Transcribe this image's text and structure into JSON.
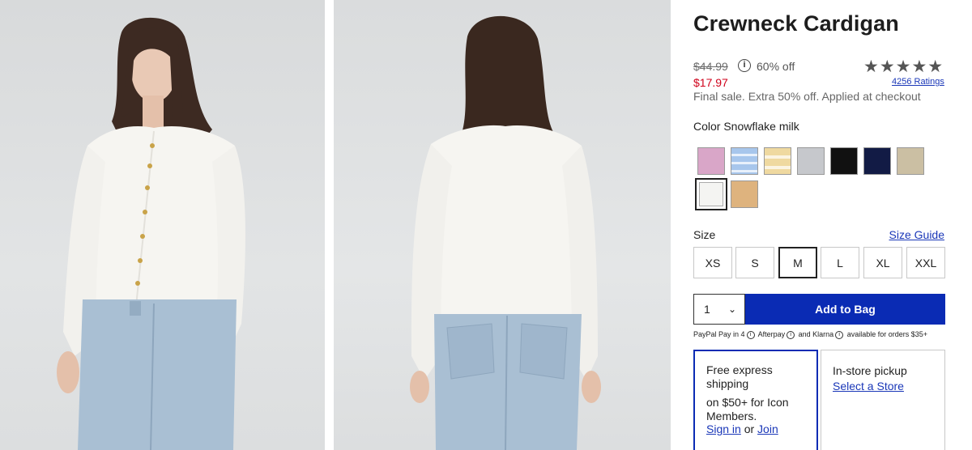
{
  "product": {
    "title": "Crewneck Cardigan",
    "original_price": "$44.99",
    "discount": "60% off",
    "sale_price": "$17.97",
    "final_sale_note": "Final sale. Extra 50% off. Applied at checkout",
    "rating_stars": 4.5,
    "ratings_link": "4256 Ratings"
  },
  "color": {
    "label": "Color Snowflake milk",
    "swatches": [
      {
        "name": "pink",
        "color": "#d9a6c8"
      },
      {
        "name": "blue-stripe",
        "color": "#a7c6ec"
      },
      {
        "name": "yellow-stripe",
        "color": "#efd9a0"
      },
      {
        "name": "grey",
        "color": "#c6c8cc"
      },
      {
        "name": "black",
        "color": "#111111"
      },
      {
        "name": "navy",
        "color": "#121b45"
      },
      {
        "name": "oatmeal",
        "color": "#cbbfa3"
      },
      {
        "name": "snowflake-milk",
        "color": "#f4f4f2",
        "selected": true
      },
      {
        "name": "camel",
        "color": "#deb37e"
      }
    ]
  },
  "size": {
    "label": "Size",
    "guide_link": "Size Guide",
    "options": [
      "XS",
      "S",
      "M",
      "L",
      "XL",
      "XXL"
    ],
    "selected": "M"
  },
  "purchase": {
    "quantity": "1",
    "add_to_bag": "Add to Bag",
    "pay_paypal": "PayPal Pay in 4",
    "pay_afterpay": "Afterpay",
    "pay_and": "and",
    "pay_klarna": "Klarna",
    "pay_tail": "available for orders $35+"
  },
  "fulfillment": {
    "shipping_title": "Free express shipping",
    "shipping_detail": "on $50+ for Icon Members.",
    "sign_in": "Sign in",
    "or": "or",
    "join": "Join",
    "pickup_title": "In-store pickup",
    "pickup_link": "Select a Store"
  }
}
